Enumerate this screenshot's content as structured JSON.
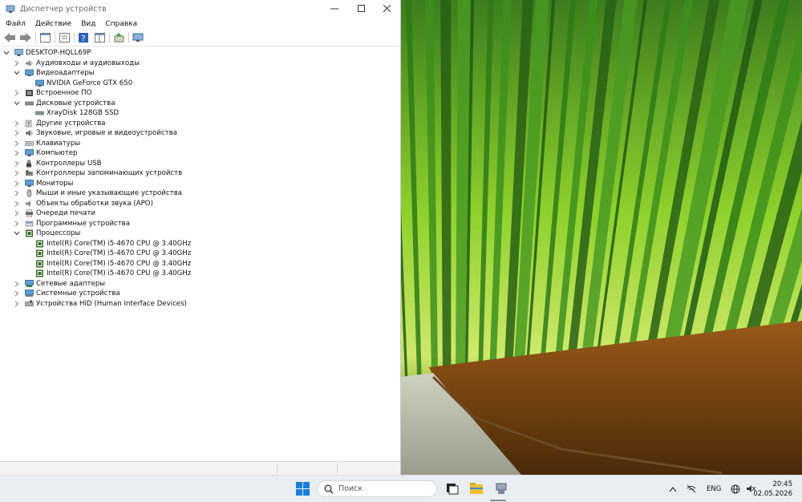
{
  "window": {
    "title": "Диспетчер устройств",
    "menu": [
      "Файл",
      "Действие",
      "Вид",
      "Справка"
    ]
  },
  "tree": {
    "root": "DESKTOP-HQLL69P",
    "rows": [
      {
        "label": "Аудиовходы и аудиовыходы",
        "level": 1,
        "expanded": false,
        "icon": "audio-icon"
      },
      {
        "label": "Видеоадаптеры",
        "level": 1,
        "expanded": true,
        "icon": "display-adapter-icon"
      },
      {
        "label": "NVIDIA GeForce GTX 650",
        "level": 2,
        "icon": "display-adapter-icon"
      },
      {
        "label": "Встроенное ПО",
        "level": 1,
        "expanded": false,
        "icon": "firmware-icon"
      },
      {
        "label": "Дисковые устройства",
        "level": 1,
        "expanded": true,
        "icon": "disk-icon"
      },
      {
        "label": "XrayDisk 128GB SSD",
        "level": 2,
        "icon": "disk-icon"
      },
      {
        "label": "Другие устройства",
        "level": 1,
        "expanded": false,
        "icon": "unknown-device-icon"
      },
      {
        "label": "Звуковые, игровые и видеоустройства",
        "level": 1,
        "expanded": false,
        "icon": "sound-icon"
      },
      {
        "label": "Клавиатуры",
        "level": 1,
        "expanded": false,
        "icon": "keyboard-icon"
      },
      {
        "label": "Компьютер",
        "level": 1,
        "expanded": false,
        "icon": "computer-icon"
      },
      {
        "label": "Контроллеры USB",
        "level": 1,
        "expanded": false,
        "icon": "usb-icon"
      },
      {
        "label": "Контроллеры запоминающих устройств",
        "level": 1,
        "expanded": false,
        "icon": "storage-controller-icon"
      },
      {
        "label": "Мониторы",
        "level": 1,
        "expanded": false,
        "icon": "monitor-icon"
      },
      {
        "label": "Мыши и иные указывающие устройства",
        "level": 1,
        "expanded": false,
        "icon": "mouse-icon"
      },
      {
        "label": "Объекты обработки звука (APO)",
        "level": 1,
        "expanded": false,
        "icon": "audio-apo-icon"
      },
      {
        "label": "Очереди печати",
        "level": 1,
        "expanded": false,
        "icon": "printer-icon"
      },
      {
        "label": "Программные устройства",
        "level": 1,
        "expanded": false,
        "icon": "software-device-icon"
      },
      {
        "label": "Процессоры",
        "level": 1,
        "expanded": true,
        "icon": "processor-icon"
      },
      {
        "label": "Intel(R) Core(TM) i5-4670 CPU @ 3.40GHz",
        "level": 2,
        "icon": "processor-icon"
      },
      {
        "label": "Intel(R) Core(TM) i5-4670 CPU @ 3.40GHz",
        "level": 2,
        "icon": "processor-icon"
      },
      {
        "label": "Intel(R) Core(TM) i5-4670 CPU @ 3.40GHz",
        "level": 2,
        "icon": "processor-icon"
      },
      {
        "label": "Intel(R) Core(TM) i5-4670 CPU @ 3.40GHz",
        "level": 2,
        "icon": "processor-icon"
      },
      {
        "label": "Сетевые адаптеры",
        "level": 1,
        "expanded": false,
        "icon": "network-adapter-icon"
      },
      {
        "label": "Системные устройства",
        "level": 1,
        "expanded": false,
        "icon": "system-device-icon"
      },
      {
        "label": "Устройства HID (Human Interface Devices)",
        "level": 1,
        "expanded": false,
        "icon": "hid-icon"
      }
    ]
  },
  "taskbar": {
    "search_placeholder": "Поиск",
    "language": "ENG",
    "time": "20:45",
    "date": "02.05.2026"
  },
  "colors": {
    "accent": "#0a64c8",
    "icon_green": "#3b6e2c",
    "taskbar": "#e9eef3"
  }
}
